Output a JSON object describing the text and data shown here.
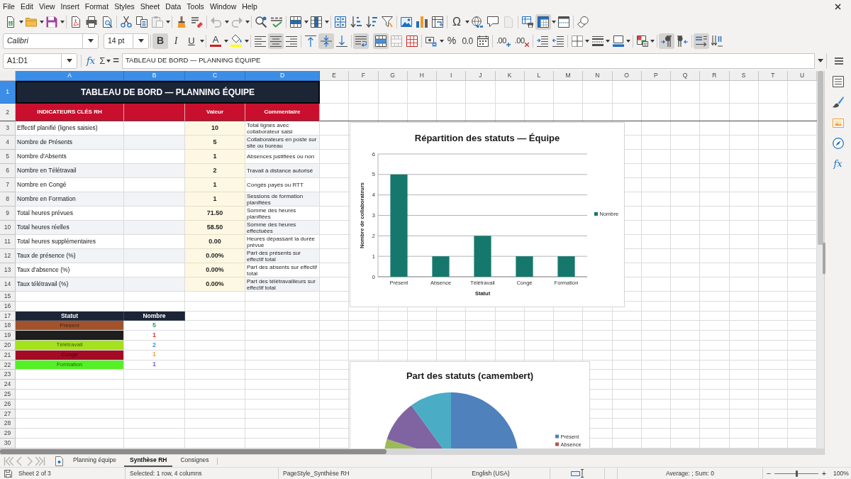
{
  "menu_bar": [
    "File",
    "Edit",
    "View",
    "Insert",
    "Format",
    "Styles",
    "Sheet",
    "Data",
    "Tools",
    "Window",
    "Help"
  ],
  "standard_toolbar": [
    {
      "on": false,
      "disabled": false
    },
    {
      "on": false,
      "disabled": false
    },
    {
      "on": false,
      "disabled": false
    },
    {
      "on": false,
      "disabled": false
    },
    {
      "on": false,
      "disabled": false
    },
    {
      "on": false,
      "disabled": false
    },
    {
      "on": false,
      "disabled": false
    },
    {
      "on": false,
      "disabled": false
    },
    {
      "on": false,
      "disabled": true
    },
    {
      "on": false,
      "disabled": false
    },
    {
      "on": false,
      "disabled": false
    },
    {
      "on": false,
      "disabled": true
    },
    {
      "on": false,
      "disabled": true
    },
    {
      "on": false,
      "disabled": false
    },
    {
      "on": false,
      "disabled": false
    },
    {
      "on": false,
      "disabled": false
    },
    {
      "on": false,
      "disabled": false
    },
    {
      "on": false,
      "disabled": false
    },
    {
      "on": false,
      "disabled": false
    },
    {
      "on": false,
      "disabled": false
    },
    {
      "on": false,
      "disabled": false
    },
    {
      "on": false,
      "disabled": false
    },
    {
      "on": false,
      "disabled": false
    },
    {
      "on": false,
      "disabled": false
    },
    {
      "glyph": "Ω",
      "on": false,
      "disabled": false
    },
    {
      "on": false,
      "disabled": false
    },
    {
      "on": false,
      "disabled": false
    },
    {
      "on": false,
      "disabled": true
    },
    {
      "on": false,
      "disabled": false
    },
    {
      "on": true,
      "disabled": false
    },
    {
      "on": false,
      "disabled": false
    },
    {
      "on": false,
      "disabled": false
    }
  ],
  "formatting_toolbar": {
    "font_name": "Calibri",
    "font_size": "14 pt",
    "buttons": [
      {
        "glyph": "B",
        "on": true,
        "disabled": false
      },
      {
        "glyph": "I",
        "on": false,
        "disabled": false
      },
      {
        "glyph": "U",
        "on": false,
        "disabled": false
      },
      {
        "glyph": "A",
        "color": "#c9211e",
        "on": false,
        "disabled": false
      },
      {
        "color": "#ffff00",
        "on": false,
        "disabled": false
      },
      {
        "on": false,
        "disabled": false
      },
      {
        "on": true,
        "disabled": false
      },
      {
        "on": false,
        "disabled": false
      },
      {
        "on": false,
        "disabled": false
      },
      {
        "on": true,
        "disabled": false
      },
      {
        "on": false,
        "disabled": false
      },
      {
        "on": true,
        "disabled": false
      },
      {
        "on": true,
        "disabled": false
      },
      {
        "on": false,
        "disabled": true
      },
      {
        "on": false,
        "disabled": false
      },
      {
        "on": false,
        "disabled": false
      },
      {
        "glyph": "%",
        "on": false,
        "disabled": false
      },
      {
        "glyph": "0.0",
        "on": false,
        "disabled": false
      },
      {
        "on": false,
        "disabled": false
      },
      {
        "glyph": ".00",
        "on": false,
        "disabled": false
      },
      {
        "glyph": ".00",
        "on": false,
        "disabled": false
      },
      {
        "on": false,
        "disabled": false
      },
      {
        "on": false,
        "disabled": false
      },
      {
        "on": false,
        "disabled": false
      },
      {
        "on": false,
        "disabled": false
      },
      {
        "on": false,
        "disabled": false
      },
      {
        "on": false,
        "disabled": false
      },
      {
        "on": true,
        "disabled": false
      },
      {
        "on": false,
        "disabled": false
      },
      {
        "on": true,
        "disabled": false
      },
      {
        "on": false,
        "disabled": false
      }
    ]
  },
  "formula_bar": {
    "name_box": "A1:D1",
    "function_glyph": "fx",
    "sum_glyph": "Σ",
    "equals_glyph": "=",
    "content": "TABLEAU DE BORD — PLANNING ÉQUIPE"
  },
  "columns": [
    {
      "label": "A",
      "selected": true
    },
    {
      "label": "B",
      "selected": true
    },
    {
      "label": "C",
      "selected": true
    },
    {
      "label": "D",
      "selected": true
    },
    {
      "label": "E",
      "selected": false
    },
    {
      "label": "F",
      "selected": false
    },
    {
      "label": "G",
      "selected": false
    },
    {
      "label": "H",
      "selected": false
    },
    {
      "label": "I",
      "selected": false
    },
    {
      "label": "J",
      "selected": false
    },
    {
      "label": "K",
      "selected": false
    },
    {
      "label": "L",
      "selected": false
    },
    {
      "label": "M",
      "selected": false
    },
    {
      "label": "N",
      "selected": false
    },
    {
      "label": "O",
      "selected": false
    },
    {
      "label": "P",
      "selected": false
    },
    {
      "label": "Q",
      "selected": false
    },
    {
      "label": "R",
      "selected": false
    },
    {
      "label": "S",
      "selected": false
    },
    {
      "label": "T",
      "selected": false
    },
    {
      "label": "U",
      "selected": false
    }
  ],
  "rows": [
    {
      "label": "1",
      "selected": true
    },
    {
      "label": "2",
      "selected": false
    },
    {
      "label": "3",
      "selected": false
    },
    {
      "label": "4",
      "selected": false
    },
    {
      "label": "5",
      "selected": false
    },
    {
      "label": "6",
      "selected": false
    },
    {
      "label": "7",
      "selected": false
    },
    {
      "label": "8",
      "selected": false
    },
    {
      "label": "9",
      "selected": false
    },
    {
      "label": "10",
      "selected": false
    },
    {
      "label": "11",
      "selected": false
    },
    {
      "label": "12",
      "selected": false
    },
    {
      "label": "13",
      "selected": false
    },
    {
      "label": "14",
      "selected": false
    },
    {
      "label": "15",
      "selected": false
    },
    {
      "label": "16",
      "selected": false
    },
    {
      "label": "17",
      "selected": false
    },
    {
      "label": "18",
      "selected": false
    },
    {
      "label": "19",
      "selected": false
    },
    {
      "label": "20",
      "selected": false
    },
    {
      "label": "21",
      "selected": false
    },
    {
      "label": "22",
      "selected": false
    },
    {
      "label": "23",
      "selected": false
    },
    {
      "label": "24",
      "selected": false
    },
    {
      "label": "25",
      "selected": false
    },
    {
      "label": "26",
      "selected": false
    },
    {
      "label": "27",
      "selected": false
    },
    {
      "label": "28",
      "selected": false
    },
    {
      "label": "29",
      "selected": false
    },
    {
      "label": "30",
      "selected": false
    }
  ],
  "sheet": {
    "title": "TABLEAU DE BORD — PLANNING ÉQUIPE",
    "indicator_header": {
      "indicator": "INDICATEURS CLÉS RH",
      "value": "Valeur",
      "comment": "Commentaire"
    },
    "indicators": [
      {
        "indicator": "Effectif planifié (lignes saisies)",
        "value": "10",
        "comment": "Total lignes avec collaborateur saisi"
      },
      {
        "indicator": "Nombre de Présents",
        "value": "5",
        "comment": "Collaborateurs en poste sur site ou bureau"
      },
      {
        "indicator": "Nombre d'Absents",
        "value": "1",
        "comment": "Absences justifiées ou non"
      },
      {
        "indicator": "Nombre en Télétravail",
        "value": "2",
        "comment": "Travail à distance autorisé"
      },
      {
        "indicator": "Nombre en Congé",
        "value": "1",
        "comment": "Congés payés ou RTT"
      },
      {
        "indicator": "Nombre en Formation",
        "value": "1",
        "comment": "Sessions de formation planifiées"
      },
      {
        "indicator": "Total heures prévues",
        "value": "71.50",
        "comment": "Somme des heures planifiées"
      },
      {
        "indicator": "Total heures réelles",
        "value": "58.50",
        "comment": "Somme des heures effectuées"
      },
      {
        "indicator": "Total heures supplémentaires",
        "value": "0.00",
        "comment": "Heures dépassant la durée prévue"
      },
      {
        "indicator": "Taux de présence (%)",
        "value": "0.00%",
        "comment": "Part des présents sur effectif total"
      },
      {
        "indicator": "Taux d'absence (%)",
        "value": "0.00%",
        "comment": "Part des absents sur effectif total"
      },
      {
        "indicator": "Taux télétravail (%)",
        "value": "0.00%",
        "comment": "Part des télétravailleurs sur effectif total"
      }
    ],
    "status_table": {
      "header": {
        "status": "Statut",
        "count": "Nombre"
      },
      "rows": [
        {
          "status": {
            "text": "Présent",
            "color": "#a3532b"
          },
          "count": {
            "text": "5",
            "color": "#2e9b5f"
          }
        },
        {
          "status": {
            "color": "#1e1e1e"
          },
          "count": {
            "text": "1",
            "color": "#d93b3b"
          }
        },
        {
          "status": {
            "text": "Télétravail",
            "color": "#a3e21c"
          },
          "count": {
            "text": "2",
            "color": "#3a9ad9"
          }
        },
        {
          "status": {
            "text": "Congé",
            "color": "#a50b25"
          },
          "count": {
            "text": "1",
            "color": "#f0a22e"
          }
        },
        {
          "status": {
            "text": "Formation",
            "color": "#55f026"
          },
          "count": {
            "text": "1",
            "color": "#7a63e0"
          }
        }
      ]
    }
  },
  "bar_chart": {
    "chart_data": {
      "type": "bar",
      "title": "Répartition des statuts — Équipe",
      "xlabel": "Statut",
      "ylabel": "Nombre de collaborateurs",
      "categories": [
        "Présent",
        "Absence",
        "Télétravail",
        "Congé",
        "Formation"
      ],
      "series": [
        {
          "name": "Nombre",
          "color": "#16786c",
          "values": [
            5,
            1,
            2,
            1,
            1
          ]
        }
      ],
      "ylim": [
        0,
        6
      ],
      "yticks": [
        0,
        1,
        2,
        3,
        4,
        5,
        6
      ],
      "grid": true
    }
  },
  "pie_chart": {
    "title": "Part des statuts (camembert)",
    "legend": [
      {
        "label": "Présent",
        "color": "#4f81bd"
      },
      {
        "label": "Absence",
        "color": "#c0504d"
      }
    ]
  },
  "sidebar": {
    "functions_glyph": "fx"
  },
  "sheet_tabs": {
    "navigation_disabled": true,
    "tabs": [
      {
        "label": "Planning équipe",
        "selected": false
      },
      {
        "label": "Synthèse RH",
        "selected": true
      },
      {
        "label": "Consignes",
        "selected": false
      }
    ]
  },
  "status_bar": {
    "sheet": "Sheet 2 of 3",
    "selection": "Selected: 1 row, 4 columns",
    "page_style": "PageStyle_Synthèse RH",
    "language": "English (USA)",
    "summary": "Average: ; Sum: 0",
    "zoom_out": "−",
    "zoom_slider": {
      "level": 0.5
    },
    "zoom_in": "+",
    "zoom": "100%"
  }
}
